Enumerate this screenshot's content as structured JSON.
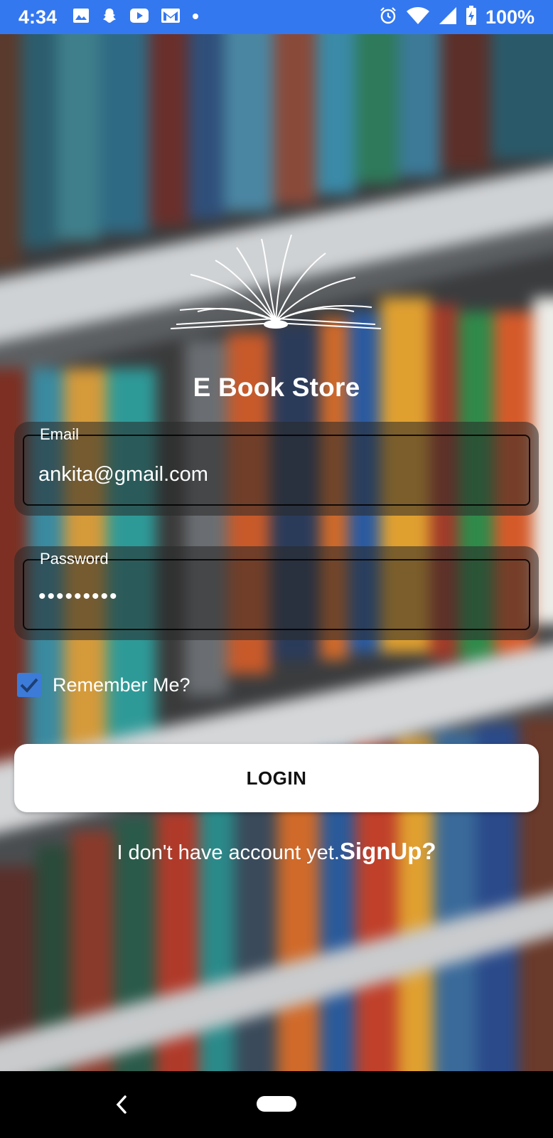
{
  "status_bar": {
    "time": "4:34",
    "battery": "100%",
    "left_icons": [
      "image-icon",
      "snapchat-icon",
      "youtube-icon",
      "gmail-icon",
      "dot-icon"
    ],
    "right_icons": [
      "alarm-icon",
      "wifi-icon",
      "signal-icon",
      "battery-charging-icon"
    ]
  },
  "app": {
    "title": "E Book Store",
    "logo_icon": "open-book-icon"
  },
  "form": {
    "email_label": "Email",
    "email_value": "ankita@gmail.com",
    "password_label": "Password",
    "password_value": "•••••••••",
    "remember_label": "Remember Me?",
    "remember_checked": true,
    "login_label": "LOGIN"
  },
  "signup": {
    "prompt": "I don't have account yet.",
    "link": "SignUp?"
  },
  "colors": {
    "status_bar": "#3478f0",
    "checkbox": "#3d7bd9",
    "button_bg": "#ffffff"
  }
}
